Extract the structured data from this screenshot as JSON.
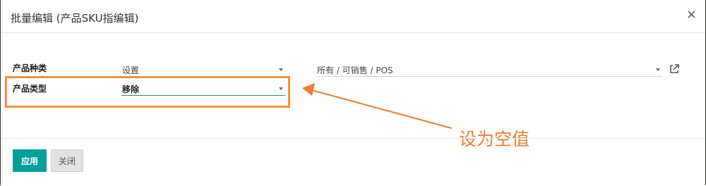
{
  "dialog": {
    "title": "批量编辑 (产品SKU指编辑)",
    "close_symbol": "×"
  },
  "fields": {
    "category": {
      "label": "产品种类",
      "action_value": "设置",
      "value": "所有 / 可销售 / POS"
    },
    "product_type": {
      "label": "产品类型",
      "action_value": "移除"
    }
  },
  "annotation": {
    "text": "设为空值",
    "color": "#ed7d31"
  },
  "footer": {
    "apply_label": "应用",
    "close_label": "关闭"
  },
  "colors": {
    "primary": "#00a09d",
    "highlight": "#f2913d"
  }
}
